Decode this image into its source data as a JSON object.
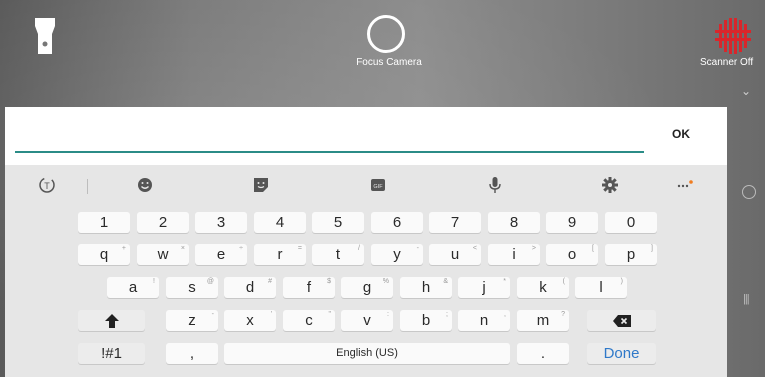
{
  "camera": {
    "focus_label": "Focus Camera",
    "scanner_label": "Scanner Off",
    "scanner_color": "#d9262b",
    "icons": [
      "flashlight-icon",
      "focus-ring-icon",
      "scanner-icon",
      "chevron-down-icon",
      "home-circle-icon",
      "recents-icon"
    ]
  },
  "input": {
    "value": "",
    "ok_label": "OK",
    "accent_color": "#2b8c87"
  },
  "keyboard": {
    "toolbar": [
      "clipboard-icon",
      "emoji-icon",
      "sticker-icon",
      "gif-icon",
      "microphone-icon",
      "settings-icon",
      "more-icon"
    ],
    "gif_label": "GIF",
    "number_row": [
      {
        "label": "1"
      },
      {
        "label": "2"
      },
      {
        "label": "3"
      },
      {
        "label": "4"
      },
      {
        "label": "5"
      },
      {
        "label": "6"
      },
      {
        "label": "7"
      },
      {
        "label": "8"
      },
      {
        "label": "9"
      },
      {
        "label": "0"
      }
    ],
    "row1": [
      {
        "label": "q",
        "hint": "+"
      },
      {
        "label": "w",
        "hint": "×"
      },
      {
        "label": "e",
        "hint": "÷"
      },
      {
        "label": "r",
        "hint": "="
      },
      {
        "label": "t",
        "hint": "/"
      },
      {
        "label": "y",
        "hint": "-"
      },
      {
        "label": "u",
        "hint": "<"
      },
      {
        "label": "i",
        "hint": ">"
      },
      {
        "label": "o",
        "hint": "["
      },
      {
        "label": "p",
        "hint": "]"
      }
    ],
    "row2": [
      {
        "label": "a",
        "hint": "!"
      },
      {
        "label": "s",
        "hint": "@"
      },
      {
        "label": "d",
        "hint": "#"
      },
      {
        "label": "f",
        "hint": "$"
      },
      {
        "label": "g",
        "hint": "%"
      },
      {
        "label": "h",
        "hint": "&"
      },
      {
        "label": "j",
        "hint": "*"
      },
      {
        "label": "k",
        "hint": "("
      },
      {
        "label": "l",
        "hint": ")"
      }
    ],
    "row3": [
      {
        "label": "z",
        "hint": "-"
      },
      {
        "label": "x",
        "hint": "'"
      },
      {
        "label": "c",
        "hint": "\""
      },
      {
        "label": "v",
        "hint": ":"
      },
      {
        "label": "b",
        "hint": ";"
      },
      {
        "label": "n",
        "hint": ","
      },
      {
        "label": "m",
        "hint": "?"
      }
    ],
    "symbols_label": "!#1",
    "comma_label": ",",
    "space_label": "English (US)",
    "period_label": ".",
    "done_label": "Done"
  }
}
